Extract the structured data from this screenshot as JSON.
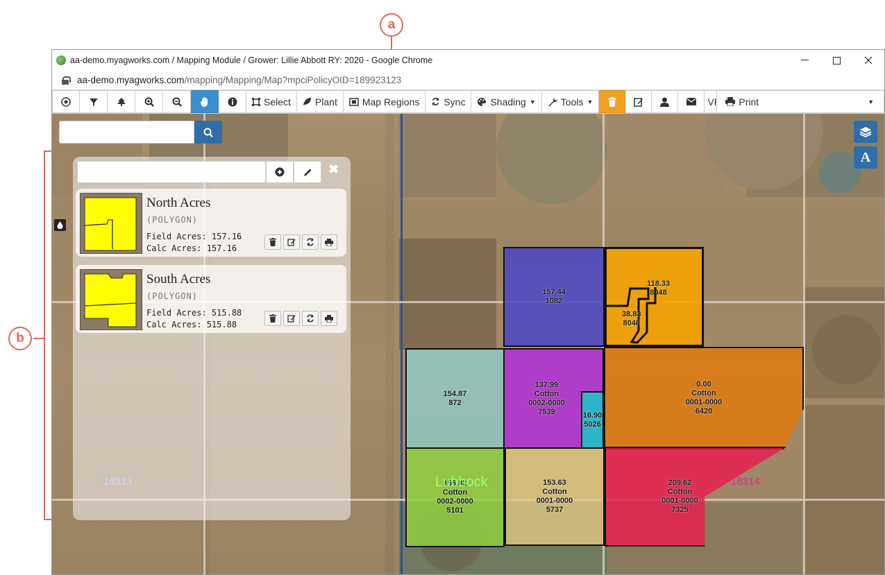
{
  "callouts": {
    "a": "a",
    "b": "b"
  },
  "window": {
    "title": "aa-demo.myagworks.com / Mapping Module / Grower: Lillie Abbott RY: 2020 - Google Chrome",
    "url_host": "aa-demo.myagworks.com",
    "url_path": "/mapping/Mapping/Map?mpciPolicyOID=189923123"
  },
  "toolbar": {
    "select": "Select",
    "plant": "Plant",
    "map_regions": "Map Regions",
    "sync": "Sync",
    "shading": "Shading",
    "tools": "Tools",
    "vf": "VF",
    "print": "Print"
  },
  "map": {
    "search_placeholder": "",
    "layers_icon": "layers-icon",
    "labels_icon": "A",
    "region_labels": {
      "left": "16313",
      "right": "16314",
      "lubbock": "Lubbock"
    },
    "parcels": [
      {
        "acres": "157.44",
        "id": "1082",
        "color": "#4b45c8"
      },
      {
        "acres": "118.33",
        "id": "8048",
        "color": "#f5a300"
      },
      {
        "acres": "38.83",
        "id": "8048",
        "color": "#f5a300"
      },
      {
        "acres": "154.87",
        "id": "872",
        "color": "#8fd0d0"
      },
      {
        "acres": "137.99",
        "crop": "Cotton",
        "code": "0002-0000",
        "id": "7539",
        "color": "#b030d8"
      },
      {
        "acres": "16.90",
        "id": "5026",
        "color": "#20c0c8"
      },
      {
        "acres": "0.00",
        "crop": "Cotton",
        "code": "0001-0000",
        "id": "6420",
        "color": "#e07a10"
      },
      {
        "acres": "155.82",
        "crop": "Cotton",
        "code": "0002-0000",
        "id": "5101",
        "color": "#8fd040"
      },
      {
        "acres": "153.63",
        "crop": "Cotton",
        "code": "0001-0000",
        "id": "5737",
        "color": "#e0c880"
      },
      {
        "acres": "209.62",
        "crop": "Cotton",
        "code": "0001-0000",
        "id": "7325",
        "color": "#e82050"
      }
    ]
  },
  "panel": {
    "input_placeholder": "",
    "close": "✖",
    "fields": [
      {
        "name": "North Acres",
        "type": "(POLYGON)",
        "field_acres": "Field Acres: 157.16",
        "calc_acres": "Calc Acres: 157.16"
      },
      {
        "name": "South Acres",
        "type": "(POLYGON)",
        "field_acres": "Field Acres: 515.88",
        "calc_acres": "Calc Acres: 515.88"
      }
    ]
  },
  "colors": {
    "accent": "#3a8fd1",
    "orange": "#f0a020",
    "callout": "#e06a55"
  }
}
